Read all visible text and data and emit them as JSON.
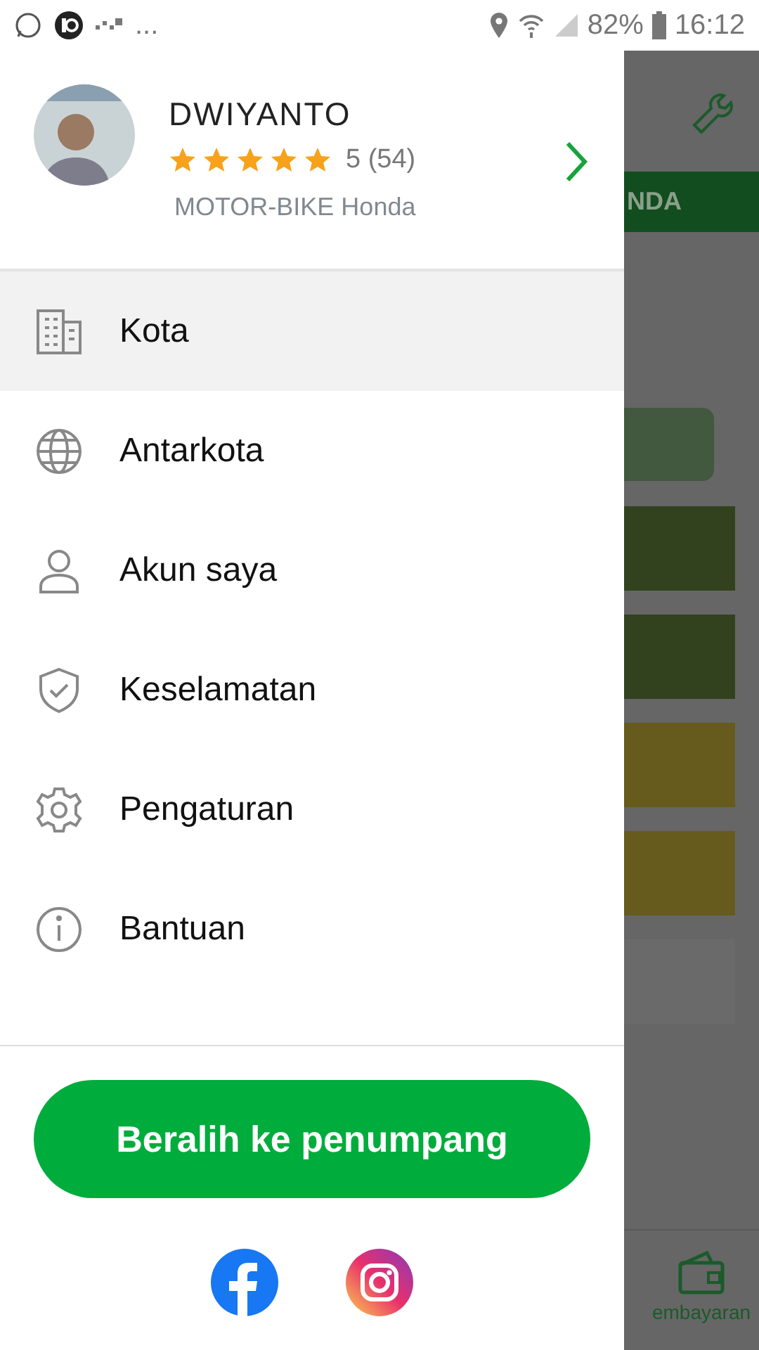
{
  "status_bar": {
    "overflow": "...",
    "battery": "82%",
    "time": "16:12"
  },
  "profile": {
    "name": "DWIYANTO",
    "stars": 5,
    "rating": "5 (54)",
    "vehicle": "MOTOR-BIKE Honda"
  },
  "menu": [
    {
      "label": "Kota",
      "selected": true
    },
    {
      "label": "Antarkota",
      "selected": false
    },
    {
      "label": "Akun saya",
      "selected": false
    },
    {
      "label": "Keselamatan",
      "selected": false
    },
    {
      "label": "Pengaturan",
      "selected": false
    },
    {
      "label": "Bantuan",
      "selected": false
    }
  ],
  "switch_button": "Beralih ke penumpang",
  "background": {
    "banner": "NDA",
    "nav_label": "embayaran"
  }
}
